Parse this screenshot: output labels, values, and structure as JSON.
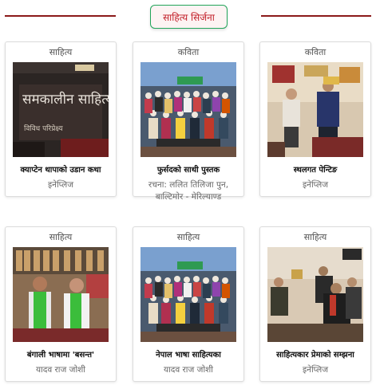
{
  "section": {
    "title": "साहित्य सिर्जना"
  },
  "colors": {
    "rule": "#8b1a1a",
    "pill_border": "#22a55a",
    "pill_text": "#c3202a"
  },
  "cards": [
    {
      "category": "साहित्य",
      "title": "क्याप्टेन थापाको उडान कथा",
      "author": "इनेप्लिज",
      "image": "book-cover",
      "cover_title": "समकालीन साहित्य",
      "cover_subtitle": "विविध परिप्रेक्ष्य"
    },
    {
      "category": "कविता",
      "title": "फुर्सदको साथी पुस्तक",
      "author": "रचना: ललित तिलिजा पुन, बाल्टिमोर - मेरिल्याण्ड",
      "image": "group-photo"
    },
    {
      "category": "कविता",
      "title": "स्थलगत पेन्टिङ",
      "author": "इनेप्लिज",
      "image": "award-photo"
    },
    {
      "category": "साहित्य",
      "title": "बंगाली भाषामा 'बसन्त'",
      "author": "यादव राज जोशी",
      "image": "felicitation-photo"
    },
    {
      "category": "साहित्य",
      "title": "नेपाल भाषा साहित्यका",
      "author": "यादव राज जोशी",
      "image": "group-photo"
    },
    {
      "category": "साहित्य",
      "title": "साहित्यकार प्रेमाको सम्झना",
      "author": "इनेप्लिज",
      "image": "meeting-photo"
    }
  ]
}
